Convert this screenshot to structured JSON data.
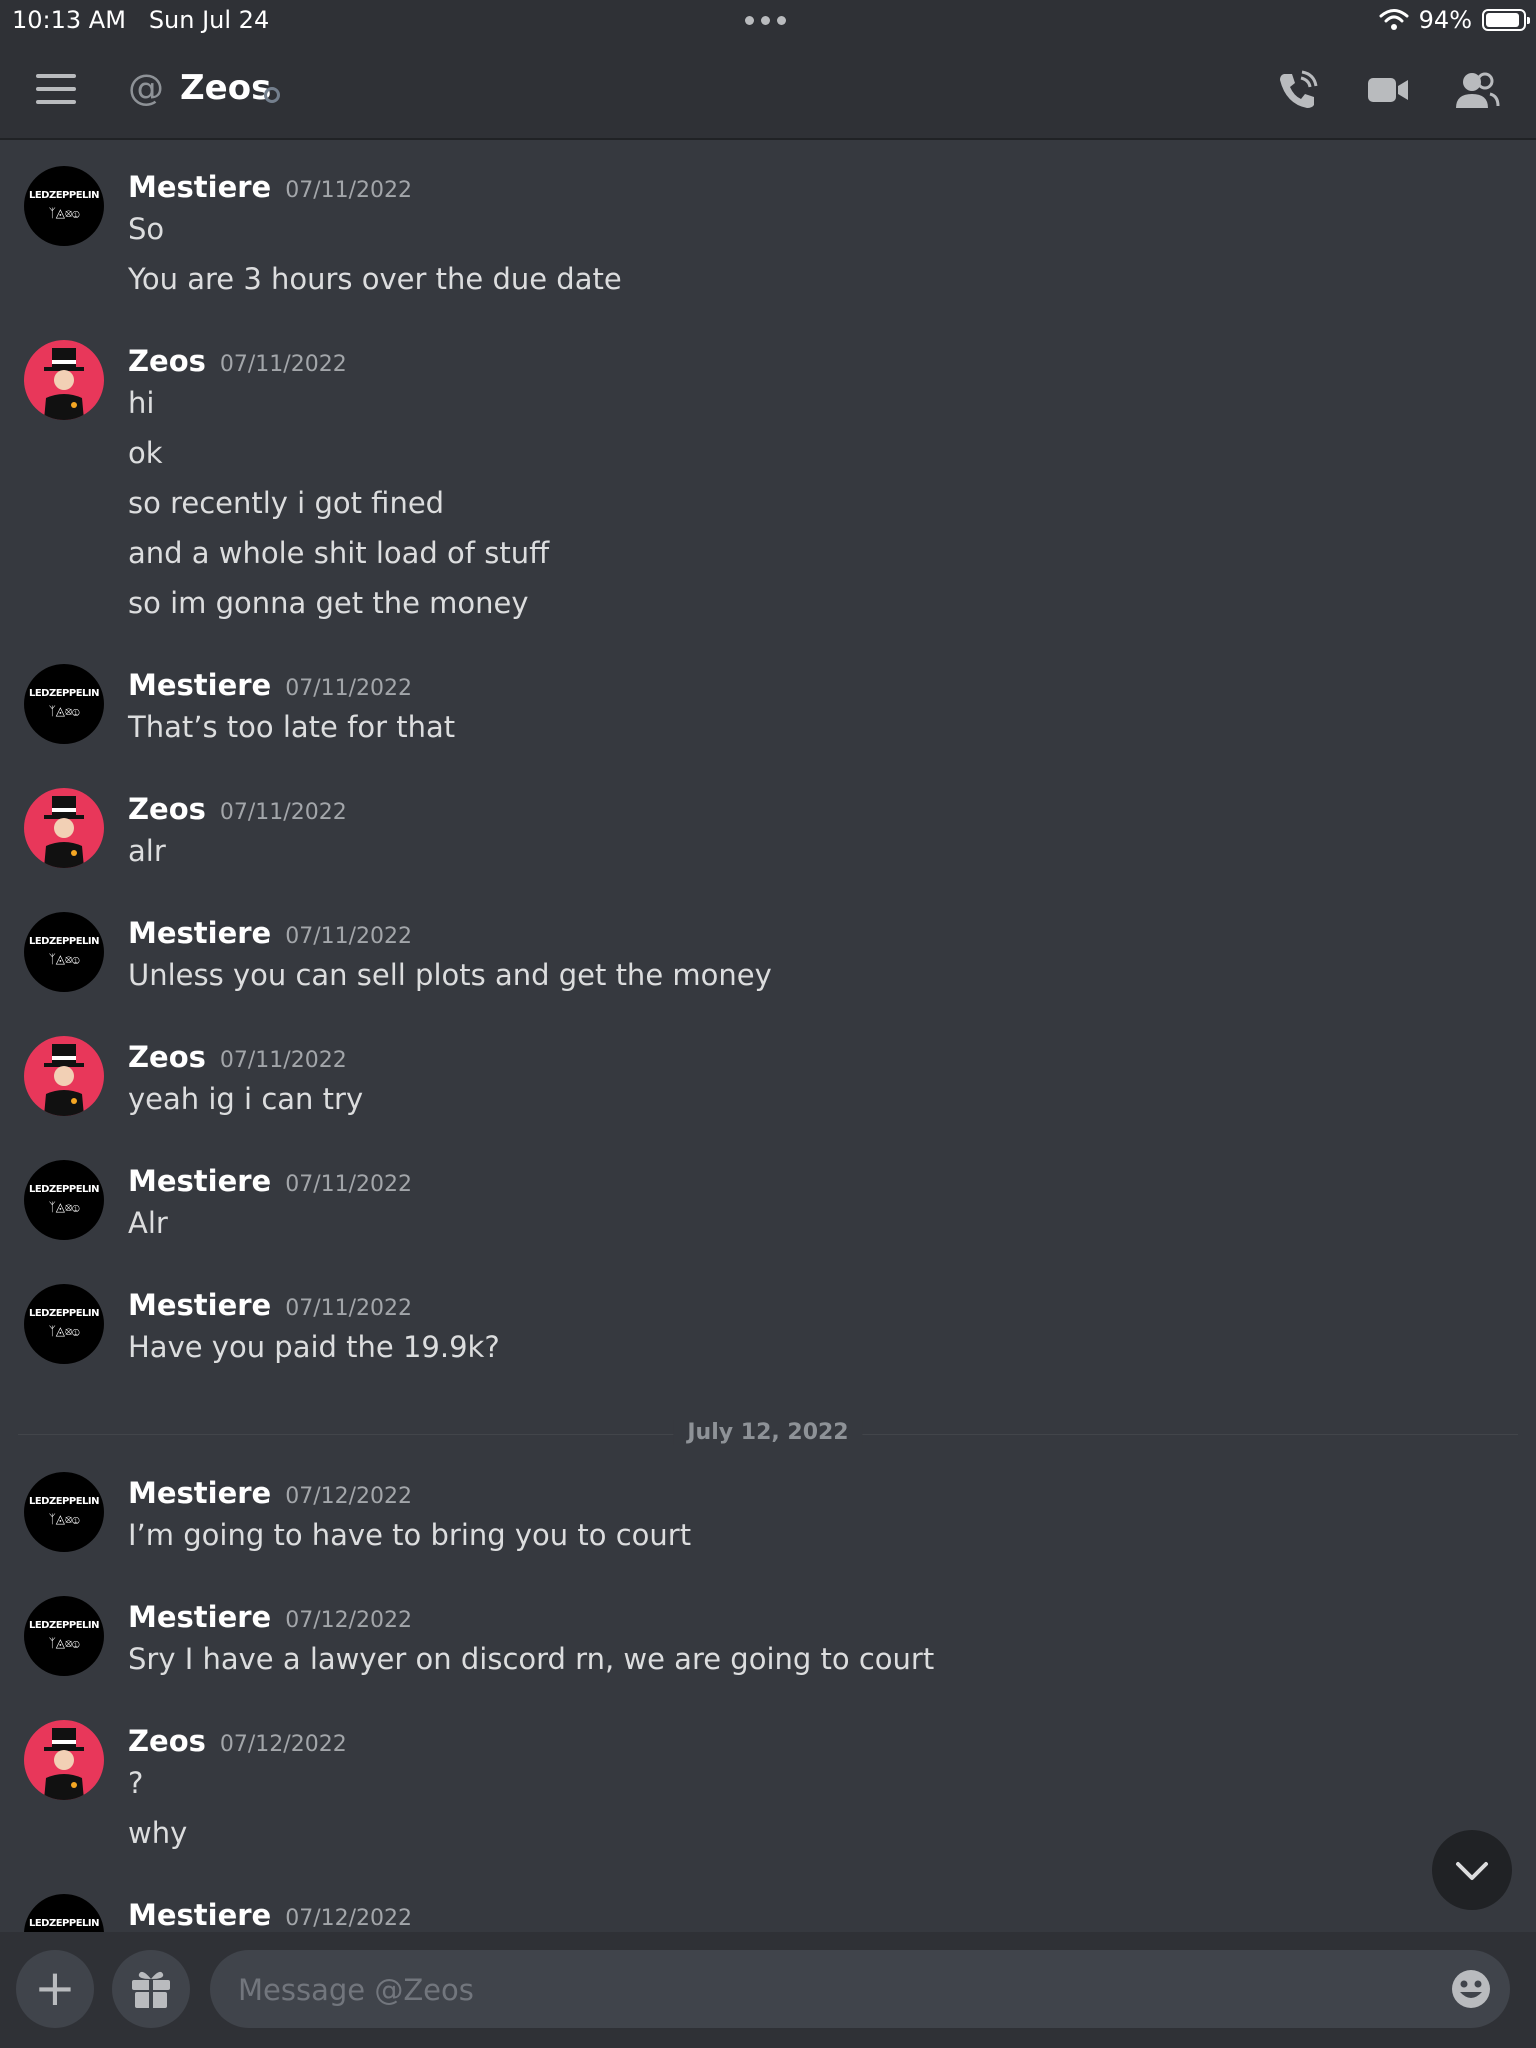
{
  "status_bar": {
    "time": "10:13 AM",
    "date": "Sun Jul 24",
    "battery": "94%",
    "battery_level": 0.94
  },
  "header": {
    "title": "Zeos",
    "icons": [
      "menu-icon",
      "at-icon",
      "call-icon",
      "video-icon",
      "member-list-icon"
    ]
  },
  "messages": [
    {
      "author": "Mestiere",
      "timestamp": "07/11/2022",
      "lines": [
        "So",
        "You are 3 hours over the due date"
      ]
    },
    {
      "author": "Zeos",
      "timestamp": "07/11/2022",
      "lines": [
        "hi",
        "ok",
        "so recently i got fined",
        "and a whole shit load of stuff",
        "so im gonna get the money"
      ]
    },
    {
      "author": "Mestiere",
      "timestamp": "07/11/2022",
      "lines": [
        "That’s too late for that"
      ]
    },
    {
      "author": "Zeos",
      "timestamp": "07/11/2022",
      "lines": [
        "alr"
      ]
    },
    {
      "author": "Mestiere",
      "timestamp": "07/11/2022",
      "lines": [
        "Unless you can sell plots and get the money"
      ]
    },
    {
      "author": "Zeos",
      "timestamp": "07/11/2022",
      "lines": [
        "yeah ig i can try"
      ]
    },
    {
      "author": "Mestiere",
      "timestamp": "07/11/2022",
      "lines": [
        "Alr"
      ]
    },
    {
      "author": "Mestiere",
      "timestamp": "07/11/2022",
      "lines": [
        "Have you paid the 19.9k?"
      ]
    },
    {
      "author": "Mestiere",
      "timestamp": "07/12/2022",
      "lines": [
        "I’m going to have to bring you to court"
      ]
    },
    {
      "author": "Mestiere",
      "timestamp": "07/12/2022",
      "lines": [
        "Sry I have a lawyer on discord rn, we are going to court"
      ]
    },
    {
      "author": "Zeos",
      "timestamp": "07/12/2022",
      "lines": [
        "?",
        "why"
      ]
    },
    {
      "author": "Mestiere",
      "timestamp": "07/12/2022",
      "lines": []
    }
  ],
  "date_divider": "July 12, 2022",
  "avatars": {
    "Mestiere": {
      "line1": "LEDZEPPELIN",
      "line2": "ᛉ◬⦻ⓘ"
    }
  },
  "composer": {
    "placeholder": "Message @Zeos"
  },
  "colors": {
    "background": "#36393f",
    "header": "#2f3136",
    "zeos_avatar": "#e8375a"
  }
}
